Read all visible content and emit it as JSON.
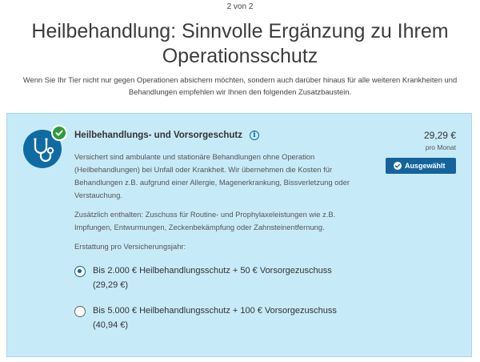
{
  "header": {
    "step": "2 von 2",
    "title": "Heilbehandlung: Sinnvolle Ergänzung zu Ihrem Operationsschutz",
    "intro": "Wenn Sie Ihr Tier nicht nur gegen Operationen absichern möchten, sondern auch darüber hinaus für alle weiteren Krankheiten und Behandlungen empfehlen wir Ihnen den folgenden Zusatzbaustein."
  },
  "product": {
    "icon": "stethoscope-icon",
    "title": "Heilbehandlungs- und Vorsorgeschutz",
    "price": "29,29 €",
    "per_month": "pro Monat",
    "selected_label": "Ausgewählt",
    "description": "Versichert sind ambulante und stationäre Behandlungen ohne Operation (Heilbehandlungen) bei Unfall oder Krankheit. Wir übernehmen die Kosten für Behandlungen z.B. aufgrund einer Allergie, Magenerkrankung, Bissverletzung oder Verstauchung.",
    "extra": "Zusätzlich enthalten: Zuschuss für Routine- und Prophylaxeleistungen wie z.B. Impfungen, Entwurmungen, Zeckenbekämpfung oder Zahnsteinentfernung.",
    "refund_label": "Erstattung pro Versicherungsjahr:",
    "options": [
      {
        "label": "Bis 2.000 € Heilbehandlungsschutz + 50 € Vorsorgezuschuss (29,29 €)",
        "selected": true
      },
      {
        "label": "Bis 5.000 € Heilbehandlungsschutz + 100 € Vorsorgezuschuss (40,94 €)",
        "selected": false
      }
    ]
  },
  "colors": {
    "card_background": "#c7eaf8",
    "primary": "#14639b",
    "success": "#2d9c3c"
  }
}
